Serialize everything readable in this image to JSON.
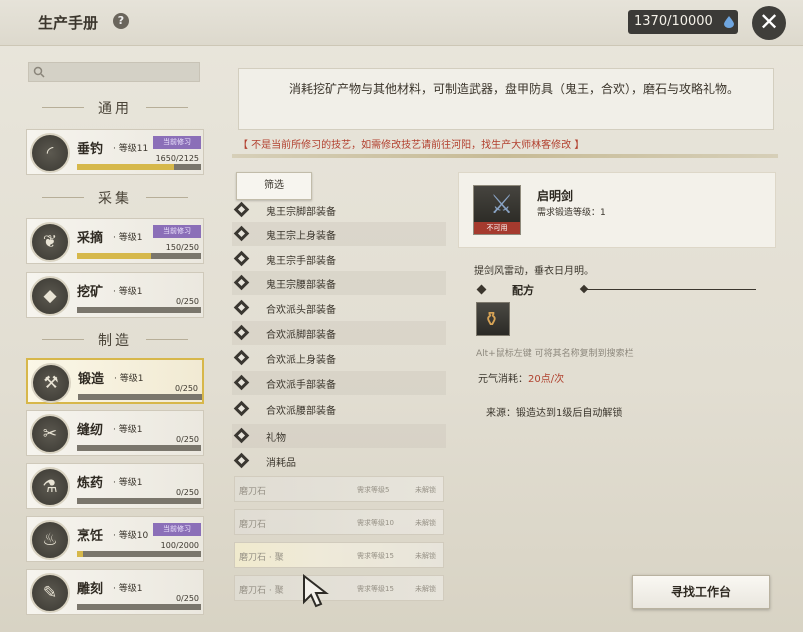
{
  "window": {
    "title": "生产手册",
    "help_icon": "?",
    "currency": "1370/10000",
    "close_icon": "✕"
  },
  "search": {
    "placeholder": ""
  },
  "sections": {
    "general": "通用",
    "gather": "采集",
    "make": "制造"
  },
  "skills": [
    {
      "name": "垂钓",
      "level": "· 等级11",
      "badge": "当前修习",
      "progress": "1650/2125",
      "fill": 0.78,
      "icon": "fishing-icon",
      "glyph": "◜"
    },
    {
      "name": "采摘",
      "level": "· 等级1",
      "badge": "当前修习",
      "progress": "150/250",
      "fill": 0.6,
      "icon": "leaf-icon",
      "glyph": "❦"
    },
    {
      "name": "挖矿",
      "level": "· 等级1",
      "badge": "",
      "progress": "0/250",
      "fill": 0,
      "icon": "ore-icon",
      "glyph": "◆"
    },
    {
      "name": "锻造",
      "level": "· 等级1",
      "badge": "",
      "progress": "0/250",
      "fill": 0,
      "icon": "anvil-icon",
      "glyph": "⚒"
    },
    {
      "name": "缝纫",
      "level": "· 等级1",
      "badge": "",
      "progress": "0/250",
      "fill": 0,
      "icon": "sewing-icon",
      "glyph": "✂"
    },
    {
      "name": "炼药",
      "level": "· 等级1",
      "badge": "",
      "progress": "0/250",
      "fill": 0,
      "icon": "potion-icon",
      "glyph": "⚗"
    },
    {
      "name": "烹饪",
      "level": "· 等级10",
      "badge": "当前修习",
      "progress": "100/2000",
      "fill": 0.05,
      "icon": "cooking-icon",
      "glyph": "♨"
    },
    {
      "name": "雕刻",
      "level": "· 等级1",
      "badge": "",
      "progress": "0/250",
      "fill": 0,
      "icon": "carving-icon",
      "glyph": "✎"
    }
  ],
  "description": "消耗挖矿产物与其他材料，可制造武器，盘甲防具（鬼王，合欢），磨石与攻略礼物。",
  "warning": "【 不是当前所修习的技艺，如需修改技艺请前往河阳，找生产大师林客修改 】",
  "filter_label": "筛选",
  "categories": [
    "鬼王宗脚部装备",
    "鬼王宗上身装备",
    "鬼王宗手部装备",
    "鬼王宗腰部装备",
    "合欢派头部装备",
    "合欢派脚部装备",
    "合欢派上身装备",
    "合欢派手部装备",
    "合欢派腰部装备",
    "礼物",
    "消耗品"
  ],
  "items": [
    {
      "name": "磨刀石",
      "req": "需求等级5",
      "lock": "未解锁"
    },
    {
      "name": "磨刀石",
      "req": "需求等级10",
      "lock": "未解锁"
    },
    {
      "name": "磨刀石 · 聚",
      "req": "需求等级15",
      "lock": "未解锁"
    },
    {
      "name": "磨刀石 · 聚",
      "req": "需求等级15",
      "lock": "未解锁"
    }
  ],
  "detail": {
    "title": "启明剑",
    "req_level": "需求锻造等级：1",
    "unusable": "不可用",
    "flavor": "提剑风雷动，垂衣日月明。",
    "formula_label": "配方",
    "copy_hint": "Alt+鼠标左键 可将其名称复制到搜索栏",
    "energy_label": "元气消耗：",
    "energy_value": "20点/次",
    "unlock_source": "来源：锻造达到1级后自动解锁"
  },
  "workbench_button": "寻找工作台",
  "colors": {
    "accent_gold": "#d6b84b",
    "badge_purple": "#8b6fb8",
    "warning_red": "#b2402f"
  }
}
